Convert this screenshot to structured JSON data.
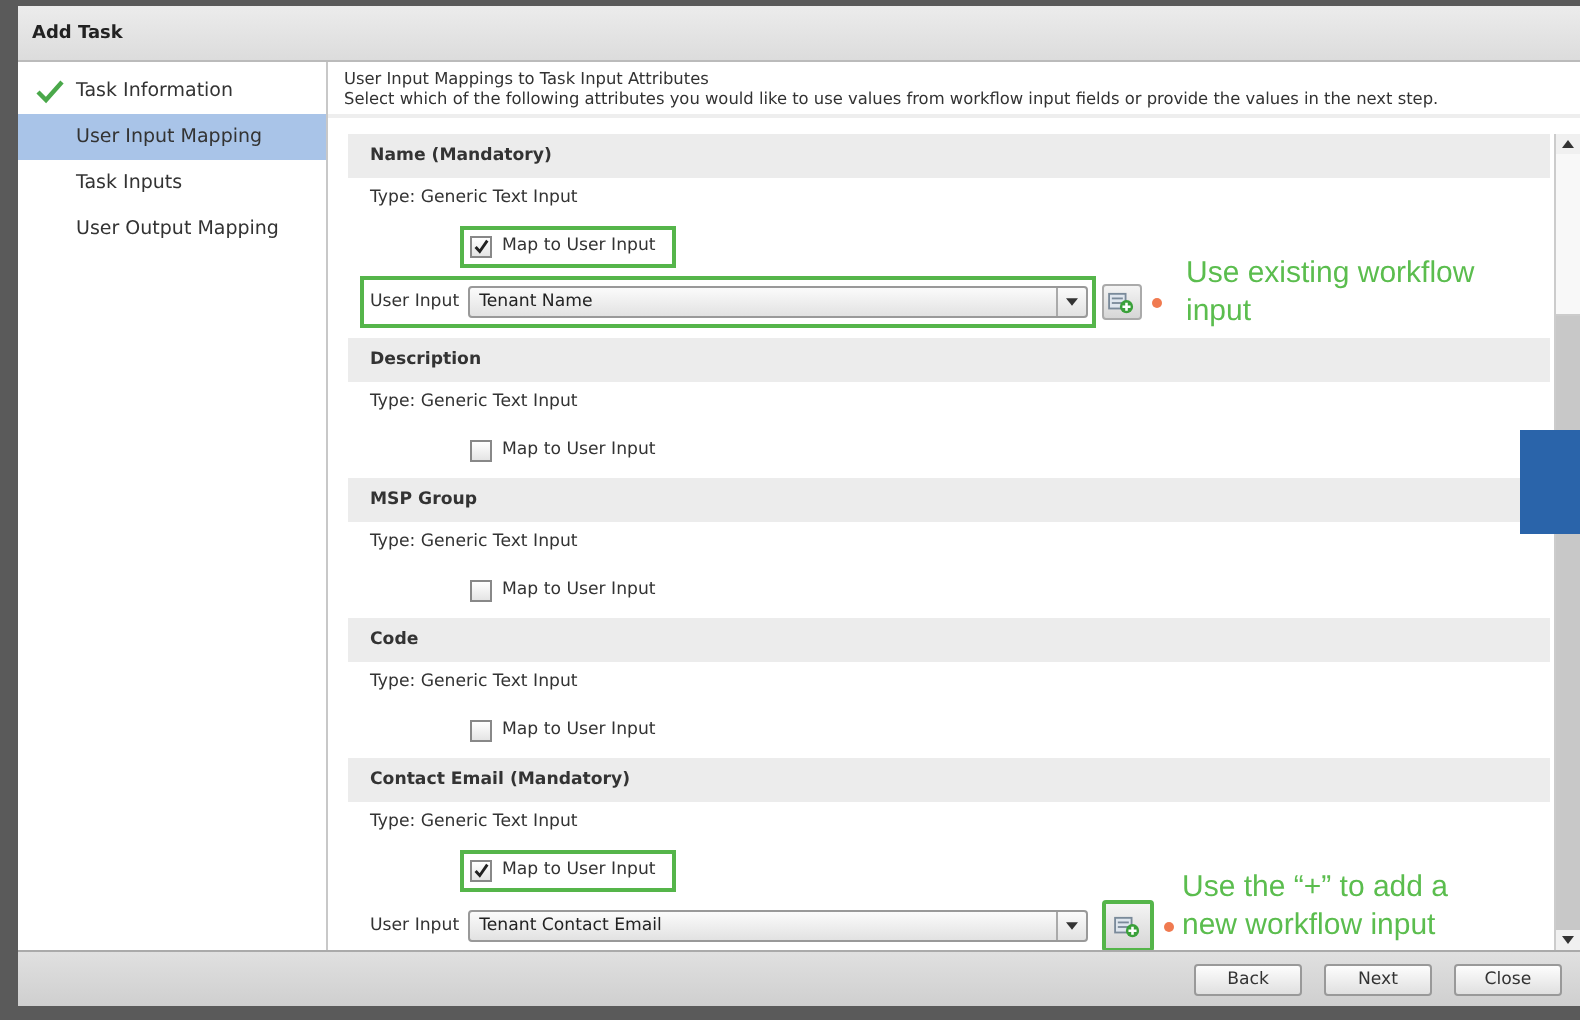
{
  "window": {
    "title": "Add Task"
  },
  "sidebar": {
    "items": [
      {
        "label": "Task Information",
        "done": true,
        "selected": false
      },
      {
        "label": "User Input Mapping",
        "done": false,
        "selected": true
      },
      {
        "label": "Task Inputs",
        "done": false,
        "selected": false
      },
      {
        "label": "User Output Mapping",
        "done": false,
        "selected": false
      }
    ]
  },
  "intro": {
    "title": "User Input Mappings to Task Input Attributes",
    "text": "Select which of the following attributes you would like to use values from workflow input fields or provide the values in the next step."
  },
  "sections": [
    {
      "name": "Name (Mandatory)",
      "type": "Type: Generic Text Input",
      "map": {
        "label": "Map to User Input",
        "checked": true,
        "highlighted": true
      },
      "user_input": {
        "label": "User Input",
        "value": "Tenant Name",
        "highlighted": true,
        "add_highlighted": false,
        "required": true
      }
    },
    {
      "name": "Description",
      "type": "Type: Generic Text Input",
      "map": {
        "label": "Map to User Input",
        "checked": false,
        "highlighted": false
      }
    },
    {
      "name": "MSP Group",
      "type": "Type: Generic Text Input",
      "map": {
        "label": "Map to User Input",
        "checked": false,
        "highlighted": false
      }
    },
    {
      "name": "Code",
      "type": "Type: Generic Text Input",
      "map": {
        "label": "Map to User Input",
        "checked": false,
        "highlighted": false
      }
    },
    {
      "name": "Contact Email (Mandatory)",
      "type": "Type: Generic Text Input",
      "map": {
        "label": "Map to User Input",
        "checked": true,
        "highlighted": true
      },
      "user_input": {
        "label": "User Input",
        "value": "Tenant Contact Email",
        "highlighted": false,
        "add_highlighted": true,
        "required": true
      }
    }
  ],
  "annotations": [
    "Use existing workflow input",
    "Use the “+” to add a new workflow input"
  ],
  "buttons": [
    "Back",
    "Next",
    "Close"
  ]
}
